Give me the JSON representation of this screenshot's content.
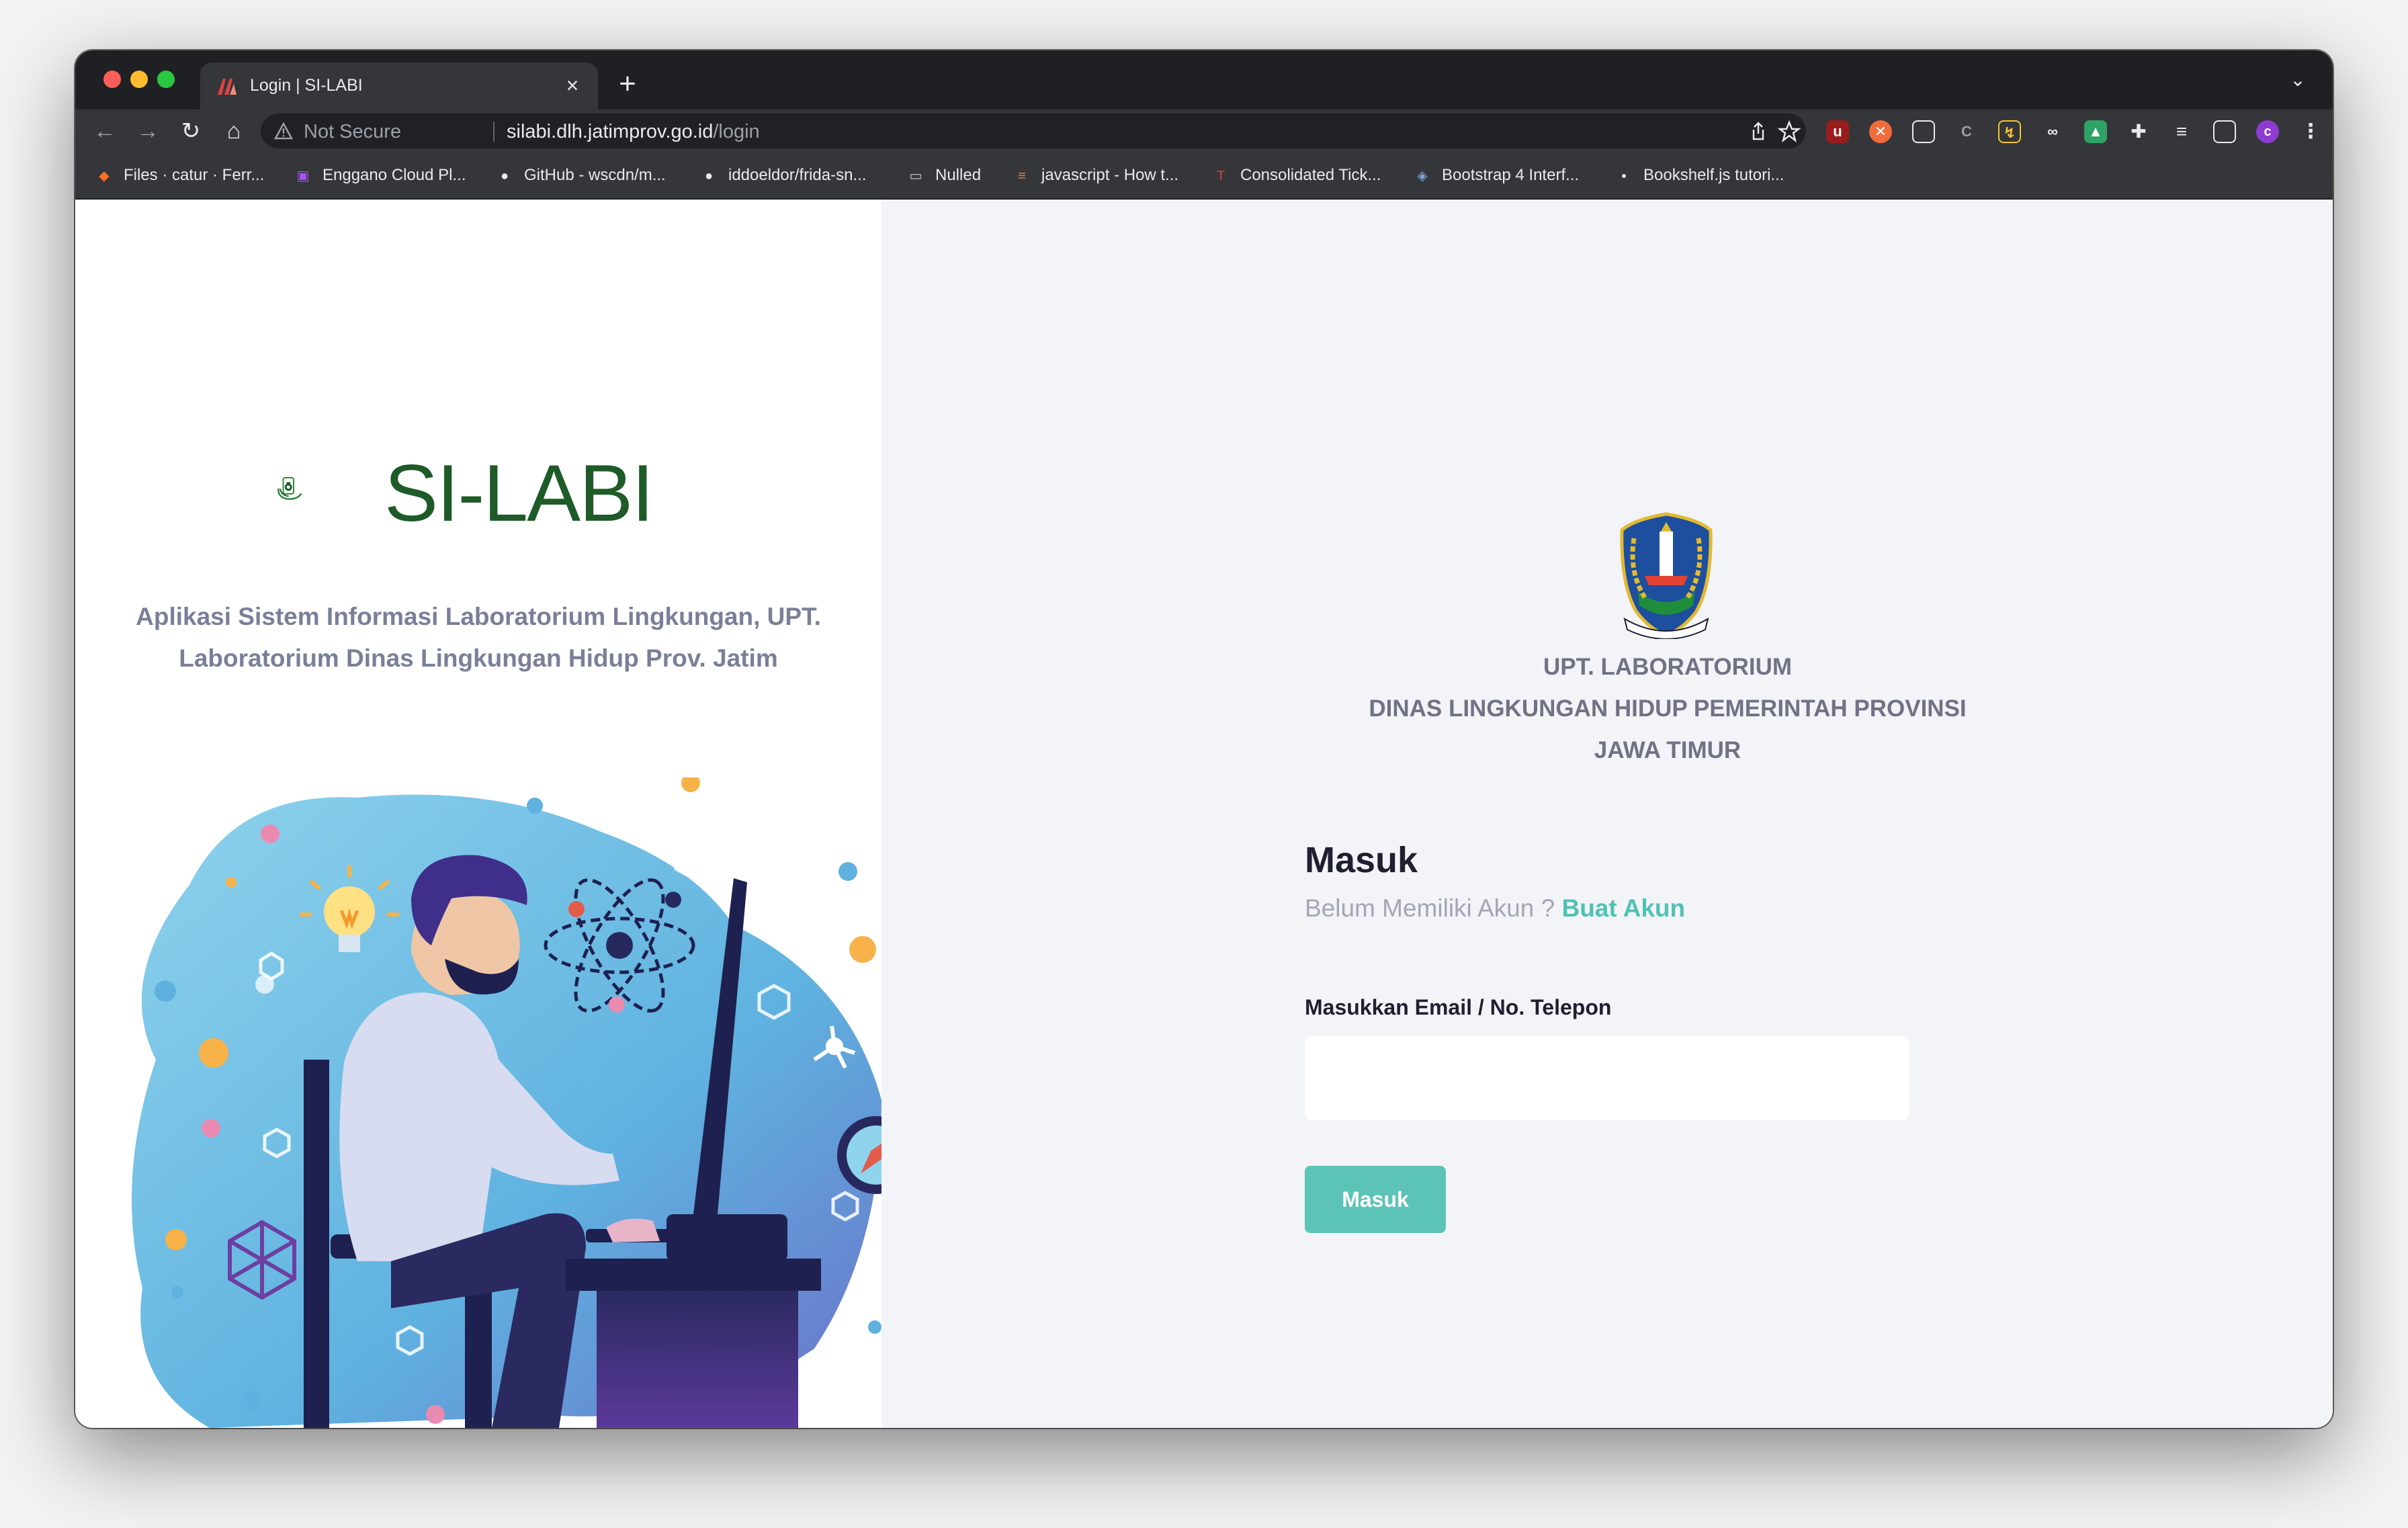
{
  "browser": {
    "tab": {
      "title": "Login | SI-LABI",
      "close_glyph": "×"
    },
    "new_tab_glyph": "+",
    "tab_menu_glyph": "⌄",
    "nav": {
      "back": "←",
      "forward": "→",
      "reload": "↻",
      "home": "⌂"
    },
    "omnibox": {
      "security_label": "Not Secure",
      "host": "silabi.dlh.jatimprov.go.id",
      "path": "/login"
    },
    "bookmarks": [
      {
        "label": "Files · catur · Ferr...",
        "icon": "gitlab-icon",
        "color": "#fc6d26",
        "glyph": "◆"
      },
      {
        "label": "Enggano Cloud Pl...",
        "icon": "app-icon",
        "color": "#a855f7",
        "glyph": "▣"
      },
      {
        "label": "GitHub - wscdn/m...",
        "icon": "github-icon",
        "color": "#e8eaed",
        "glyph": "●"
      },
      {
        "label": "iddoeldor/frida-sn...",
        "icon": "github-icon",
        "color": "#e8eaed",
        "glyph": "●"
      },
      {
        "label": "Nulled",
        "icon": "folder-icon",
        "color": "#c8cbd0",
        "glyph": "▭"
      },
      {
        "label": "javascript - How t...",
        "icon": "stackoverflow-icon",
        "color": "#f48024",
        "glyph": "≡"
      },
      {
        "label": "Consolidated Tick...",
        "icon": "ticket-icon",
        "color": "#e53935",
        "glyph": "T"
      },
      {
        "label": "Bootstrap 4 Interf...",
        "icon": "cube-icon",
        "color": "#7aa7e0",
        "glyph": "◈"
      },
      {
        "label": "Bookshelf.js tutori...",
        "icon": "square-icon",
        "color": "#ffffff",
        "glyph": "▪"
      }
    ]
  },
  "brand": {
    "name": "SI-LABI",
    "tagline": "Aplikasi Sistem Informasi Laboratorium Lingkungan, UPT. Laboratorium Dinas Lingkungan Hidup Prov. Jatim"
  },
  "org": {
    "line1": "UPT. LABORATORIUM",
    "line2": "DINAS LINGKUNGAN HIDUP PEMERINTAH PROVINSI",
    "line3": "JAWA TIMUR"
  },
  "login": {
    "heading": "Masuk",
    "register_prompt": "Belum Memiliki Akun ?",
    "register_link": "Buat Akun",
    "email_label": "Masukkan Email / No. Telepon",
    "email_value": "",
    "submit_label": "Masuk"
  },
  "colors": {
    "brand_green": "#1e5b28",
    "accent_teal": "#5cc4b6",
    "link_teal": "#4fc2b4",
    "panel_bg": "#f3f4f8"
  }
}
